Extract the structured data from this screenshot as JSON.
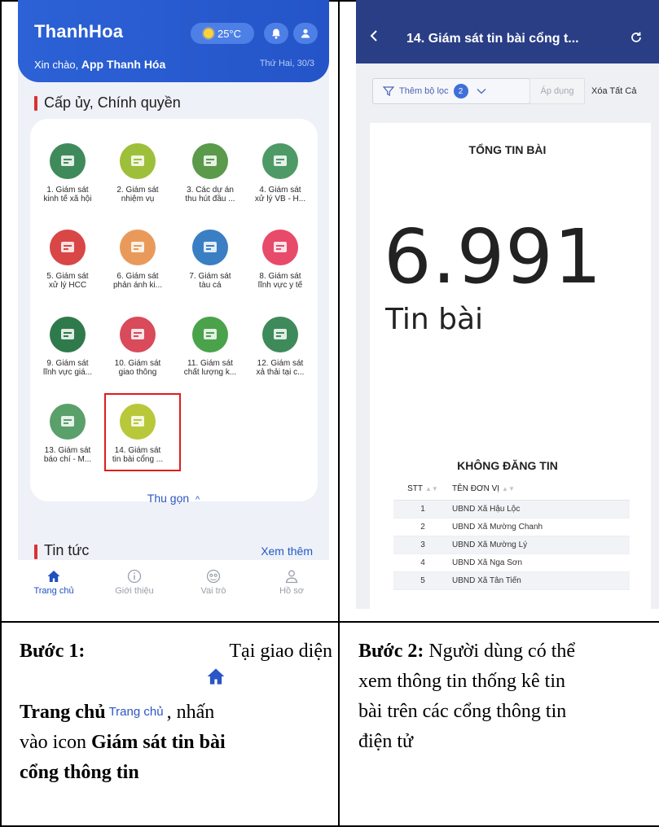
{
  "left_phone": {
    "app_name": "ThanhHoa",
    "temperature": "25°C",
    "greeting_prefix": "Xin chào,",
    "greeting_name": "App Thanh Hóa",
    "date": "Thứ Hai, 30/3",
    "section_title": "Cấp ủy, Chính quyền",
    "tiles": [
      {
        "label": "1. Giám sát\nkinh tế xã hội",
        "icon": "growth-chart-icon",
        "color": "#3f8a5a"
      },
      {
        "label": "2. Giám sát\nnhiệm vụ",
        "icon": "coins-icon",
        "color": "#9ebf3a"
      },
      {
        "label": "3. Các dự án\nthu hút đầu ...",
        "icon": "investment-hand-icon",
        "color": "#5a9a4a"
      },
      {
        "label": "4. Giám sát\nxử lý VB - H...",
        "icon": "documents-icon",
        "color": "#4d9a66"
      },
      {
        "label": "5. Giám sát\nxử lý HCC",
        "icon": "admin-procedures-icon",
        "color": "#d94646"
      },
      {
        "label": "6. Giám sát\nphản ánh ki...",
        "icon": "mail-feedback-icon",
        "color": "#e99a5a"
      },
      {
        "label": "7. Giám sát\ntàu cá",
        "icon": "fishing-ship-icon",
        "color": "#3a7fc4"
      },
      {
        "label": "8. Giám sát\nlĩnh vực y tế",
        "icon": "heartbeat-icon",
        "color": "#e84a6a"
      },
      {
        "label": "9. Giám sát\nlĩnh vực giá...",
        "icon": "graduation-cap-icon",
        "color": "#2f7a4a"
      },
      {
        "label": "10. Giám sát\ngiao thông",
        "icon": "traffic-camera-icon",
        "color": "#d94a5a"
      },
      {
        "label": "11. Giám sát\nchất lượng k...",
        "icon": "environment-globe-icon",
        "color": "#4aa34a"
      },
      {
        "label": "12. Giám sát\nxả thải tại c...",
        "icon": "factory-icon",
        "color": "#3f8a5a"
      },
      {
        "label": "13. Giám sát\nbáo chí - M...",
        "icon": "newspaper-icon",
        "color": "#5aa06a"
      },
      {
        "label": "14. Giám sát\ntin bài cổng ...",
        "icon": "portal-monitor-icon",
        "color": "#b8c83a"
      }
    ],
    "collapse_label": "Thu gọn",
    "news_title": "Tin tức",
    "see_more": "Xem thêm",
    "nav": [
      {
        "label": "Trang chủ",
        "icon": "home-icon"
      },
      {
        "label": "Giới thiệu",
        "icon": "info-icon"
      },
      {
        "label": "Vai trò",
        "icon": "role-icon"
      },
      {
        "label": "Hồ sơ",
        "icon": "profile-icon"
      }
    ]
  },
  "right_phone": {
    "title": "14. Giám sát tin bài cổng t...",
    "filter_label": "Thêm bộ lọc",
    "filter_count": "2",
    "apply_label": "Áp dụng",
    "clear_label": "Xóa Tất Cả",
    "total_title": "TỔNG TIN BÀI",
    "total_value": "6.991",
    "total_unit": "Tin bài",
    "table_title": "KHÔNG ĐĂNG TIN",
    "table_headers": [
      "STT",
      "TÊN ĐƠN VỊ"
    ],
    "rows": [
      {
        "stt": "1",
        "name": "UBND Xã Hậu Lộc"
      },
      {
        "stt": "2",
        "name": "UBND Xã Mường Chanh"
      },
      {
        "stt": "3",
        "name": "UBND Xã Mường Lý"
      },
      {
        "stt": "4",
        "name": "UBND Xã Nga Sơn"
      },
      {
        "stt": "5",
        "name": "UBND Xã Tân Tiến"
      }
    ]
  },
  "captions": {
    "step1_bold": "Bước 1:",
    "step1_a": "Tại giao diện",
    "step1_home_bold": "Trang chủ",
    "step1_home_small": "Trang chủ",
    "step1_b": ", nhấn",
    "step1_c": "vào icon",
    "step1_icon_bold": "Giám sát tin bài",
    "step1_icon_bold2": "cổng thông tin",
    "step2_bold": "Bước 2:",
    "step2_line1": "Người dùng có thể",
    "step2_line2": "xem thông tin thống kê tin",
    "step2_line3": "bài trên các cổng thông tin",
    "step2_line4": "điện tử"
  }
}
